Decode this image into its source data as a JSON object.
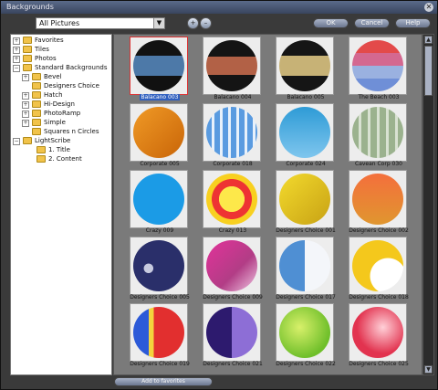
{
  "window": {
    "title": "Backgrounds",
    "close_glyph": "✕"
  },
  "toolbar": {
    "picture_select": "All Pictures",
    "ok_label": "OK",
    "cancel_label": "Cancel",
    "help_label": "Help",
    "zoom_in_glyph": "+",
    "zoom_out_glyph": "–"
  },
  "tree": {
    "items": [
      {
        "label": "Favorites"
      },
      {
        "label": "Tiles"
      },
      {
        "label": "Photos"
      },
      {
        "label": "Standard Backgrounds"
      },
      {
        "label": "Bevel"
      },
      {
        "label": "Designers Choice"
      },
      {
        "label": "Hatch"
      },
      {
        "label": "Hi-Design"
      },
      {
        "label": "PhotoRamp"
      },
      {
        "label": "Simple"
      },
      {
        "label": "Squares n Circles"
      },
      {
        "label": "LightScribe"
      },
      {
        "label": "1. Title"
      },
      {
        "label": "2. Content"
      }
    ]
  },
  "gallery": {
    "items": [
      {
        "caption": "Balacano 003"
      },
      {
        "caption": "Balacano 004"
      },
      {
        "caption": "Balacano 005"
      },
      {
        "caption": "The Beach 003"
      },
      {
        "caption": "Corporate 005"
      },
      {
        "caption": "Corporate 018"
      },
      {
        "caption": "Corporate 024"
      },
      {
        "caption": "Cavean Corp 030"
      },
      {
        "caption": "Crazy 009"
      },
      {
        "caption": "Crazy 013"
      },
      {
        "caption": "Designers Choice 001"
      },
      {
        "caption": "Designers Choice 002"
      },
      {
        "caption": "Designers Choice 005"
      },
      {
        "caption": "Designers Choice 009"
      },
      {
        "caption": "Designers Choice 017"
      },
      {
        "caption": "Designers Choice 018"
      },
      {
        "caption": "Designers Choice 019"
      },
      {
        "caption": "Designers Choice 021"
      },
      {
        "caption": "Designers Choice 022"
      },
      {
        "caption": "Designers Choice 025"
      }
    ]
  },
  "footer": {
    "add_favorites_label": "Add to favorites"
  }
}
